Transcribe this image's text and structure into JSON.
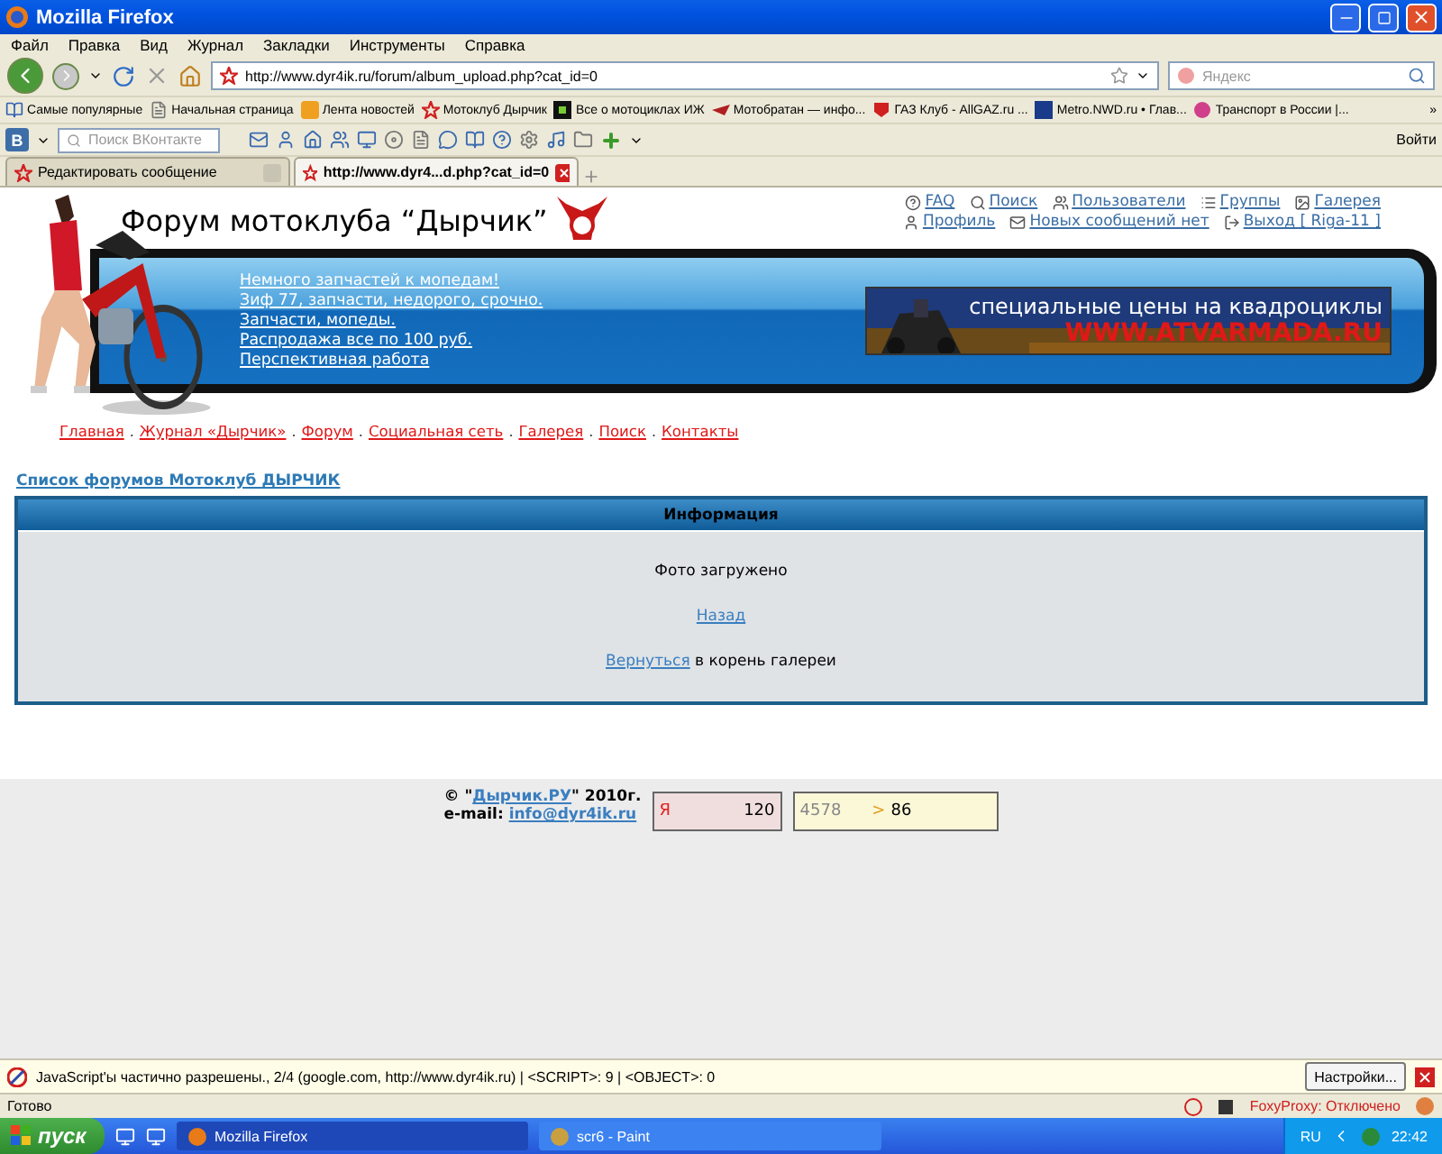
{
  "window": {
    "title": "Mozilla Firefox"
  },
  "menu": [
    "Файл",
    "Правка",
    "Вид",
    "Журнал",
    "Закладки",
    "Инструменты",
    "Справка"
  ],
  "nav": {
    "url": "http://www.dyr4ik.ru/forum/album_upload.php?cat_id=0",
    "search_placeholder": "Яндекс"
  },
  "bookmarks": [
    "Самые популярные",
    "Начальная страница",
    "Лента новостей",
    "Мотоклуб Дырчик",
    "Все о мотоциклах ИЖ",
    "Мотобратан — инфо...",
    "ГАЗ Клуб - AllGAZ.ru ...",
    "Metro.NWD.ru • Глав...",
    "Транспорт в России |..."
  ],
  "bookmarks_more": "»",
  "vk_toolbar": {
    "badge": "B",
    "search_placeholder": "Поиск ВКонтакте",
    "login": "Войти"
  },
  "tabs": [
    {
      "label": "Редактировать сообщение",
      "selected": false
    },
    {
      "label": "http://www.dyr4...d.php?cat_id=0",
      "selected": true
    }
  ],
  "page": {
    "header_title": "Форум мотоклуба “Дырчик”",
    "user_links": [
      [
        {
          "kind": "faq",
          "label": "FAQ"
        },
        {
          "kind": "search",
          "label": "Поиск"
        },
        {
          "kind": "users",
          "label": "Пользователи"
        },
        {
          "kind": "groups",
          "label": "Группы"
        },
        {
          "kind": "gallery",
          "label": "Галерея"
        }
      ],
      [
        {
          "kind": "profile",
          "label": "Профиль"
        },
        {
          "kind": "messages",
          "label": "Новых сообщений нет"
        },
        {
          "kind": "logout",
          "label": "Выход [ Riga-11 ]"
        }
      ]
    ],
    "news": [
      "Немного запчастей к мопедам!",
      "Зиф 77, запчасти, недорого, срочно.",
      "Запчасти, мопеды.",
      "Распродажа все по 100 руб.",
      "Перспективная работа"
    ],
    "banner": {
      "line1": "специальные цены на квадроциклы",
      "line2": "WWW.ATVARMADA.RU"
    },
    "site_nav": [
      "Главная",
      "Журнал «Дырчик»",
      "Форум",
      "Социальная сеть",
      "Галерея",
      "Поиск",
      "Контакты"
    ],
    "site_nav_separator": ".",
    "breadcrumb": "Список форумов Мотоклуб ДЫРЧИК",
    "info": {
      "title": "Информация",
      "message": "Фото загружено",
      "back": "Назад",
      "return_link": "Вернуться",
      "return_text": " в корень галереи"
    },
    "footer": {
      "copy_prefix": "© \"",
      "site_link": "Дырчик.РУ",
      "copy_suffix": "\" 2010г.",
      "email_label": "e-mail:",
      "email": "info@dyr4ik.ru",
      "counter1": {
        "logo": "Я",
        "value": "120"
      },
      "counter2": {
        "value1": "4578",
        "arrow": ">",
        "value2": "86"
      }
    }
  },
  "noscript": {
    "message": "JavaScript'ы частично разрешены., 2/4 (google.com, http://www.dyr4ik.ru) | <SCRIPT>: 9 | <OBJECT>: 0",
    "button": "Настройки..."
  },
  "status": {
    "text": "Готово",
    "proxy": "FoxyProxy: Отключено"
  },
  "taskbar": {
    "start": "пуск",
    "tasks": [
      {
        "label": "Mozilla Firefox",
        "selected": true
      },
      {
        "label": "scr6 - Paint",
        "selected": false
      }
    ],
    "lang": "RU",
    "clock": "22:42"
  }
}
